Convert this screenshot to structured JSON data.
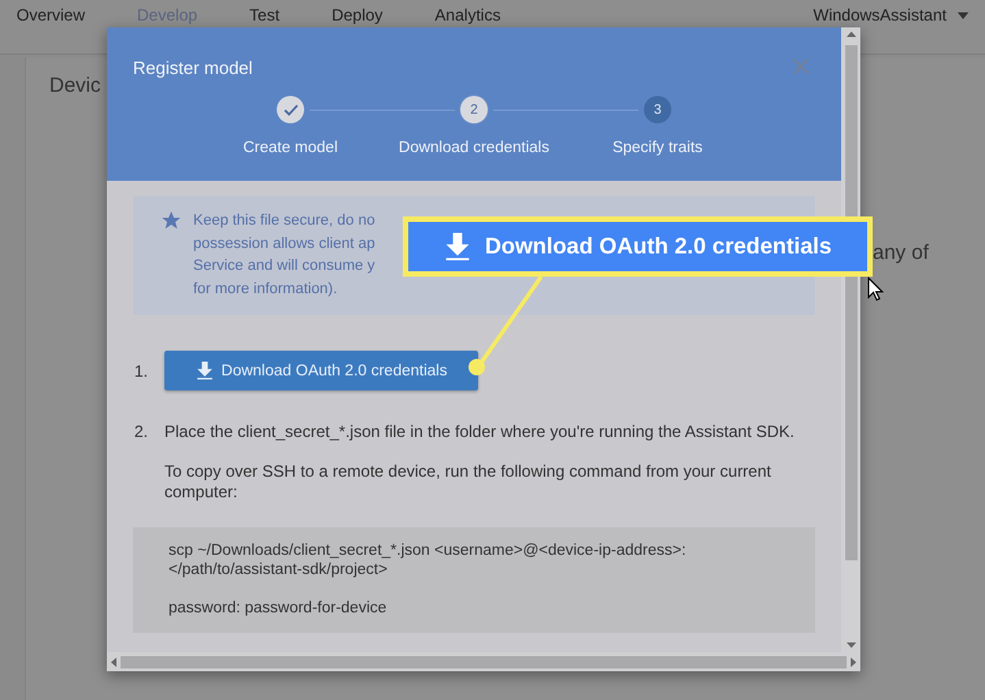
{
  "nav": {
    "tabs": [
      {
        "label": "Overview",
        "selected": false
      },
      {
        "label": "Develop",
        "selected": true
      },
      {
        "label": "Test",
        "selected": false
      },
      {
        "label": "Deploy",
        "selected": false
      },
      {
        "label": "Analytics",
        "selected": false
      }
    ],
    "account": "WindowsAssistant"
  },
  "background": {
    "heading": "Devic",
    "fragment": "any of"
  },
  "dialog": {
    "title": "Register model",
    "steps": [
      {
        "label": "Create model",
        "completed": true,
        "selected": false
      },
      {
        "label": "Download credentials",
        "completed": false,
        "selected": true,
        "number": "2"
      },
      {
        "label": "Specify traits",
        "completed": false,
        "selected": false,
        "number": "3"
      }
    ],
    "notice_lines": [
      "Keep this file secure, do no",
      "possession allows client ap",
      "Service and will consume y",
      "for more information)."
    ],
    "items": [
      {
        "marker": "1.",
        "kind": "button",
        "label": "Download OAuth 2.0 credentials"
      },
      {
        "marker": "2.",
        "kind": "text",
        "text": "Place the client_secret_*.json file in the folder where you're running the Assistant SDK.",
        "note": "To copy over SSH to a remote device, run the following command from your current computer:"
      }
    ],
    "code": [
      [
        "scp ~/Downloads/client_secret_*.json <username>@<device-ip-address>:",
        "</path/to/assistant-sdk/project>"
      ],
      [
        "password: password-for-device"
      ]
    ]
  },
  "callout": {
    "label": "Download OAuth 2.0 credentials"
  }
}
